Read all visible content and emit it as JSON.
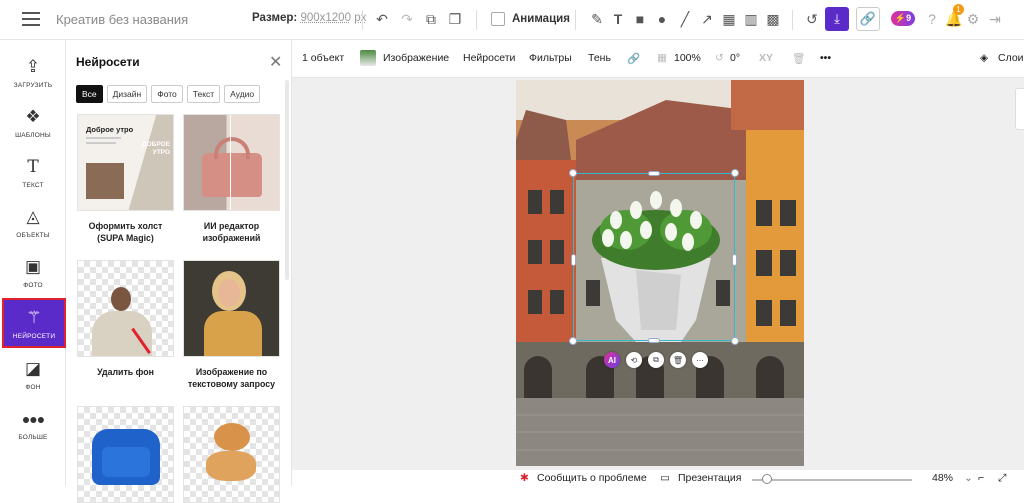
{
  "header": {
    "doc_title": "Креатив без названия",
    "size_label": "Размер:",
    "size_value": "900x1200",
    "size_unit": "px",
    "animation_label": "Анимация",
    "pro_badge": "⚡9",
    "notif_count": "1"
  },
  "leftnav": {
    "items": [
      {
        "label": "ЗАГРУЗИТЬ",
        "icon": "upload-icon"
      },
      {
        "label": "ШАБЛОНЫ",
        "icon": "templates-icon"
      },
      {
        "label": "ТЕКСТ",
        "icon": "text-icon"
      },
      {
        "label": "ОБЪЕКТЫ",
        "icon": "shapes-icon"
      },
      {
        "label": "ФОТО",
        "icon": "photo-icon"
      },
      {
        "label": "НЕЙРОСЕТИ",
        "icon": "magic-wand-icon"
      },
      {
        "label": "ФОН",
        "icon": "background-icon"
      },
      {
        "label": "БОЛЬШЕ",
        "icon": "more-icon"
      }
    ],
    "active_index": 5
  },
  "panel": {
    "title": "Нейросети",
    "filters": [
      "Все",
      "Дизайн",
      "Фото",
      "Текст",
      "Аудио"
    ],
    "active_filter": "Все",
    "cards": [
      {
        "label": "Оформить холст (SUPA Magic)",
        "thumb_text_a": "Доброе утро",
        "thumb_text_b": "ДОБРОЕ УТРО"
      },
      {
        "label": "ИИ редактор изображений"
      },
      {
        "label": "Удалить фон"
      },
      {
        "label": "Изображение по текстовому запросу"
      },
      {
        "label": ""
      },
      {
        "label": ""
      }
    ]
  },
  "context_toolbar": {
    "object_count": "1 объект",
    "image_label": "Изображение",
    "ai_label": "Нейросети",
    "filters_label": "Фильтры",
    "shadow_label": "Тень",
    "opacity_value": "100%",
    "rotation_value": "0°",
    "xy_label": "XY",
    "layers_label": "Слои"
  },
  "bottombar": {
    "report_label": "Сообщить о проблеме",
    "present_label": "Презентация",
    "zoom_value": "48%"
  },
  "colors": {
    "accent": "#5b2bc9",
    "selection": "#35b7d1",
    "highlight_border": "#e0222f"
  }
}
